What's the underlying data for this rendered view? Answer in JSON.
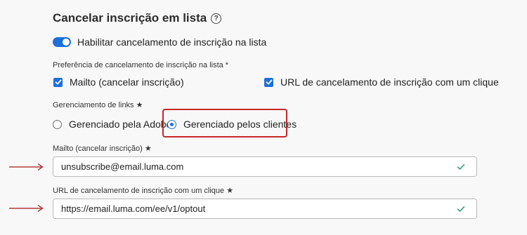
{
  "title": "Cancelar inscrição em lista",
  "help_icon": "?",
  "toggle": {
    "label": "Habilitar cancelamento de inscrição na lista",
    "on": true,
    "color": "#1e6fd9"
  },
  "preference": {
    "label": "Preferência de cancelamento de inscrição na lista *",
    "options": [
      {
        "label": "Mailto (cancelar inscrição)",
        "checked": true
      },
      {
        "label": "URL de cancelamento de inscrição com um clique",
        "checked": true
      }
    ]
  },
  "link_management": {
    "label": "Gerenciamento de links ★",
    "options": [
      {
        "label": "Gerenciado pela Adobe",
        "selected": false
      },
      {
        "label": "Gerenciado pelos clientes",
        "selected": true
      }
    ]
  },
  "mailto_field": {
    "label": "Mailto (cancelar inscrição) ★",
    "value": "unsubscribe@email.luma.com"
  },
  "url_field": {
    "label": "URL de cancelamento de inscrição com um clique ★",
    "value": "https://email.luma.com/ee/v1/optout"
  },
  "colors": {
    "accent": "#1e6fd9",
    "highlight": "#c8262a",
    "valid": "#2d9d78",
    "arrow": "#b23a3a"
  }
}
